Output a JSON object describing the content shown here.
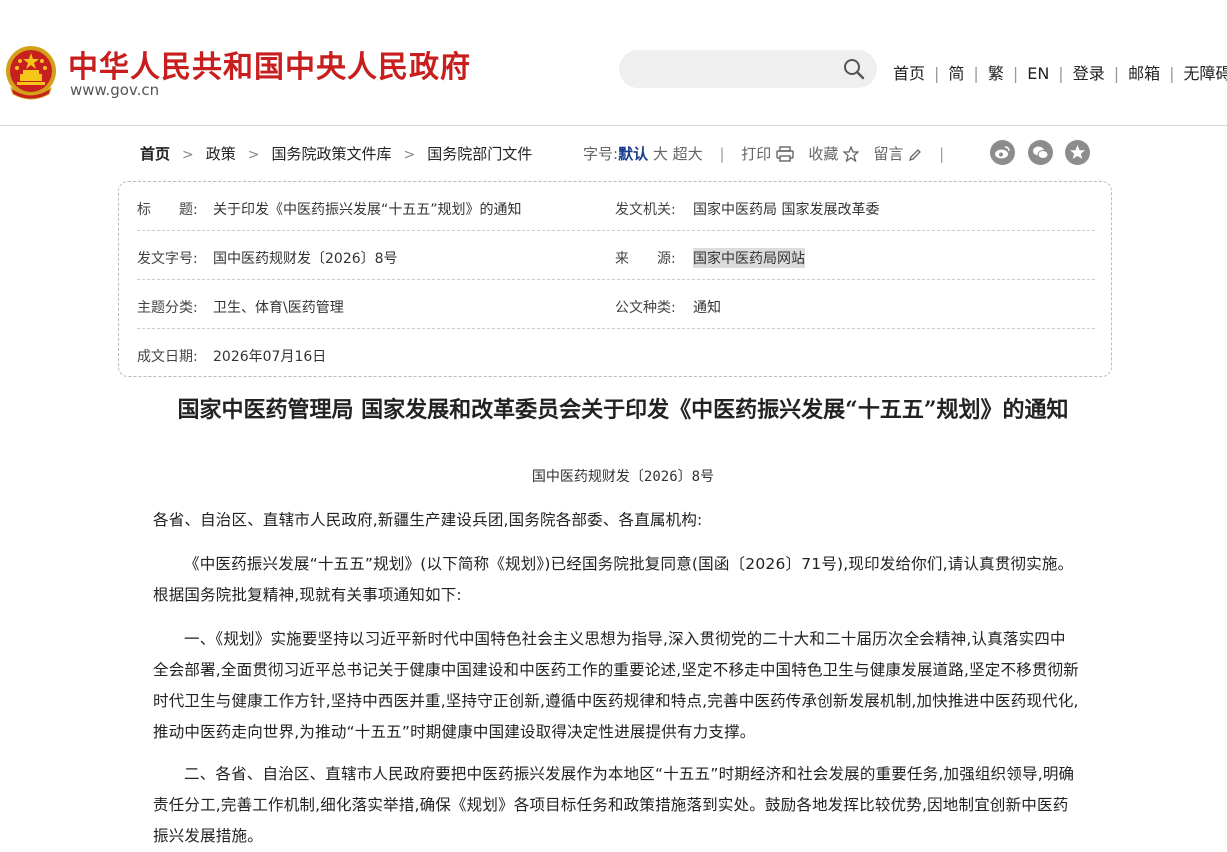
{
  "header": {
    "site_title": "中华人民共和国中央人民政府",
    "site_url": "www.gov.cn",
    "nav": [
      "首页",
      "简",
      "繁",
      "EN",
      "登录",
      "邮箱",
      "无障碍"
    ]
  },
  "breadcrumb": [
    "首页",
    "政策",
    "国务院政策文件库",
    "国务院部门文件"
  ],
  "tools": {
    "font_label": "字号:",
    "font_default": "默认",
    "font_large": "大",
    "font_xlarge": "超大",
    "print": "打印",
    "favorite": "收藏",
    "comment": "留言"
  },
  "meta": {
    "title_label": "标　　题:",
    "title_value": "关于印发《中医药振兴发展“十五五”规划》的通知",
    "issuer_label": "发文机关:",
    "issuer_value": "国家中医药局 国家发展改革委",
    "docno_label": "发文字号:",
    "docno_value": "国中医药规财发〔2026〕8号",
    "source_label": "来　　源:",
    "source_value": "国家中医药局网站",
    "topic_label": "主题分类:",
    "topic_value": "卫生、体育\\医药管理",
    "type_label": "公文种类:",
    "type_value": "通知",
    "date_label": "成文日期:",
    "date_value": "2026年07月16日"
  },
  "article": {
    "title": "国家中医药管理局 国家发展和改革委员会关于印发《中医药振兴发展“十五五”规划》的通知",
    "doc_no": "国中医药规财发〔2026〕8号",
    "p1": "各省、自治区、直辖市人民政府,新疆生产建设兵团,国务院各部委、各直属机构:",
    "p2": "《中医药振兴发展“十五五”规划》(以下简称《规划》)已经国务院批复同意(国函〔2026〕71号),现印发给你们,请认真贯彻实施。根据国务院批复精神,现就有关事项通知如下:",
    "p3": "一、《规划》实施要坚持以习近平新时代中国特色社会主义思想为指导,深入贯彻党的二十大和二十届历次全会精神,认真落实四中全会部署,全面贯彻习近平总书记关于健康中国建设和中医药工作的重要论述,坚定不移走中国特色卫生与健康发展道路,坚定不移贯彻新时代卫生与健康工作方针,坚持中西医并重,坚持守正创新,遵循中医药规律和特点,完善中医药传承创新发展机制,加快推进中医药现代化,推动中医药走向世界,为推动“十五五”时期健康中国建设取得决定性进展提供有力支撑。",
    "p4": "二、各省、自治区、直辖市人民政府要把中医药振兴发展作为本地区“十五五”时期经济和社会发展的重要任务,加强组织领导,明确责任分工,完善工作机制,细化落实举措,确保《规划》各项目标任务和政策措施落到实处。鼓励各地发挥比较优势,因地制宜创新中医药振兴发展措施。"
  }
}
